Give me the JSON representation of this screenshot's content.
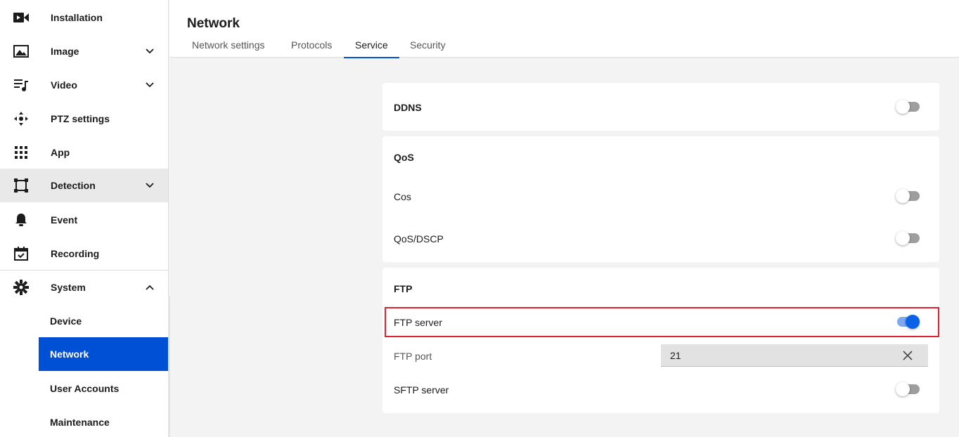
{
  "sidebar": {
    "items": [
      {
        "label": "Installation",
        "icon": "video-camera-icon"
      },
      {
        "label": "Image",
        "icon": "image-icon"
      },
      {
        "label": "Video",
        "icon": "playlist-music-icon"
      },
      {
        "label": "PTZ settings",
        "icon": "ptz-move-icon"
      },
      {
        "label": "App",
        "icon": "grid-apps-icon"
      },
      {
        "label": "Detection",
        "icon": "bounding-box-icon"
      },
      {
        "label": "Event",
        "icon": "bell-icon"
      },
      {
        "label": "Recording",
        "icon": "calendar-check-icon"
      },
      {
        "label": "System",
        "icon": "gear-icon"
      }
    ],
    "system_sub": [
      {
        "label": "Device"
      },
      {
        "label": "Network"
      },
      {
        "label": "User Accounts"
      },
      {
        "label": "Maintenance"
      }
    ]
  },
  "header": {
    "title": "Network",
    "tabs": [
      {
        "label": "Network settings"
      },
      {
        "label": "Protocols"
      },
      {
        "label": "Service"
      },
      {
        "label": "Security"
      }
    ]
  },
  "ddns": {
    "label": "DDNS",
    "enabled": false
  },
  "qos": {
    "title": "QoS",
    "cos_label": "Cos",
    "dscp_label": "QoS/DSCP"
  },
  "ftp": {
    "title": "FTP",
    "server_label": "FTP server",
    "port_label": "FTP port",
    "port_value": "21",
    "sftp_label": "SFTP server"
  },
  "colors": {
    "accent": "#0050d6",
    "toggle_on": "#0a62e8",
    "highlight": "#e0212f"
  }
}
